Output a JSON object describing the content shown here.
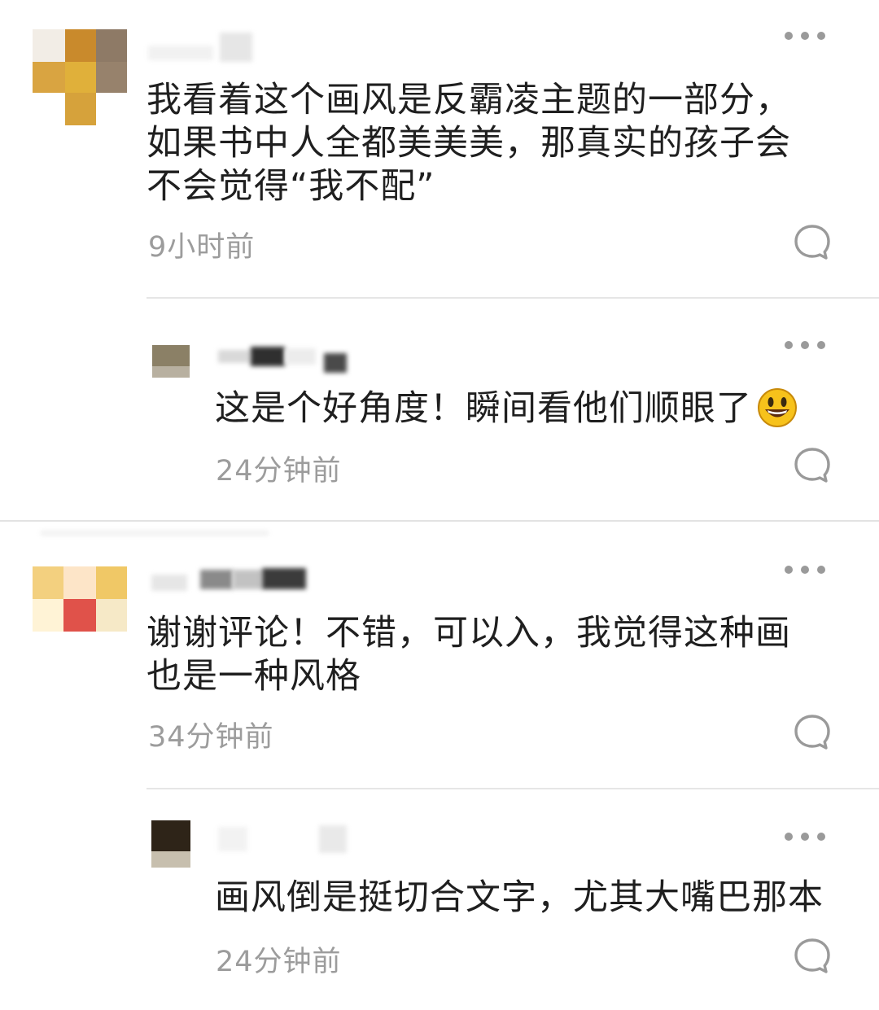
{
  "comments": [
    {
      "text": "我看着这个画风是反霸凌主题的一部分，\n如果书中人全都美美美，那真实的孩子会\n不会觉得“我不配”",
      "time": "9小时前",
      "reply": {
        "text": "这是个好角度！瞬间看他们顺眼了",
        "emoji": "smiley-emoji",
        "time": "24分钟前"
      }
    },
    {
      "text": "谢谢评论！不错，可以入，我觉得这种画\n也是一种风格",
      "time": "34分钟前",
      "reply": {
        "text": "画风倒是挺切合文字，尤其大嘴巴那本",
        "time": "24分钟前"
      }
    }
  ],
  "icons": {
    "more": "more-icon",
    "reply": "comment-bubble-icon"
  },
  "colors": {
    "text": "#1f1f1f",
    "meta": "#9c9c9c",
    "icon": "#9a9a9a",
    "divider": "#e6e6e6"
  }
}
